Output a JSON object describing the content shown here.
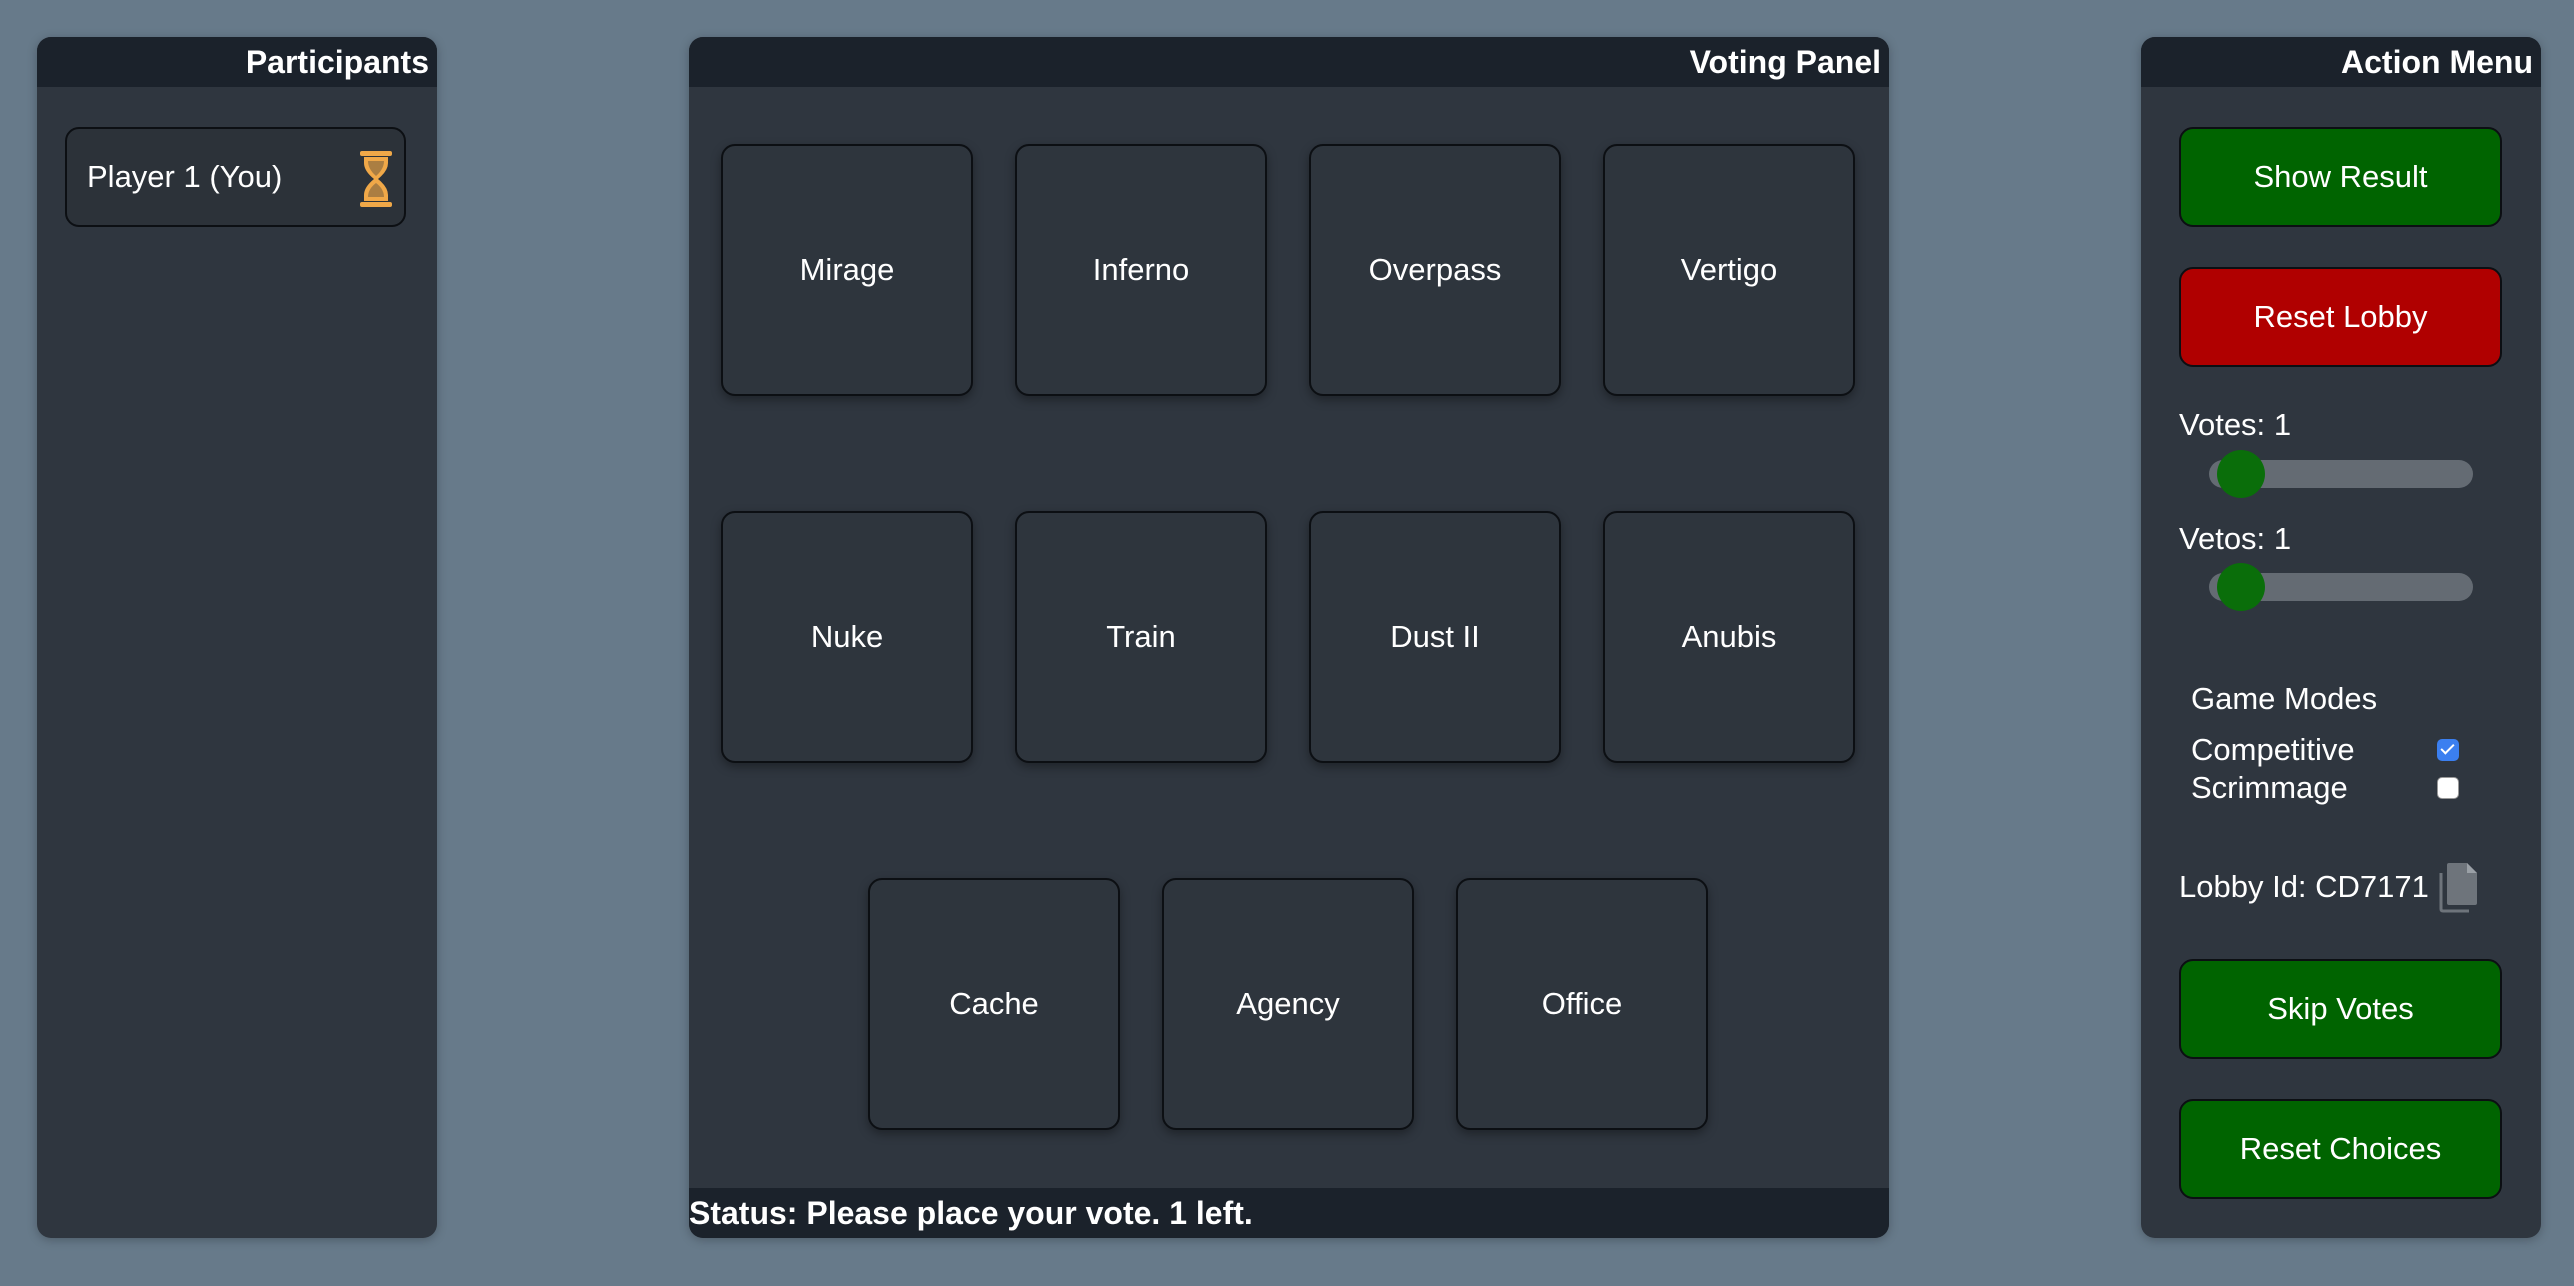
{
  "participants": {
    "title": "Participants",
    "players": [
      {
        "name": "Player 1 (You)",
        "status_icon": "hourglass-icon"
      }
    ]
  },
  "voting": {
    "title": "Voting Panel",
    "maps": [
      "Mirage",
      "Inferno",
      "Overpass",
      "Vertigo",
      "Nuke",
      "Train",
      "Dust II",
      "Anubis",
      "Cache",
      "Agency",
      "Office"
    ],
    "status": "Status: Please place your vote. 1 left."
  },
  "actions": {
    "title": "Action Menu",
    "show_result": "Show Result",
    "reset_lobby": "Reset Lobby",
    "votes_label": "Votes:",
    "votes_value": "1",
    "vetos_label": "Vetos:",
    "vetos_value": "1",
    "game_modes_title": "Game Modes",
    "modes": [
      {
        "label": "Competitive",
        "checked": true
      },
      {
        "label": "Scrimmage",
        "checked": false
      }
    ],
    "lobby_id": "Lobby Id: CD7171",
    "skip_votes": "Skip Votes",
    "reset_choices": "Reset Choices"
  },
  "colors": {
    "background": "#677a8a",
    "panel": "#2f363f",
    "header": "#1b222b",
    "green_button": "#006400",
    "red_button": "#b00000",
    "hourglass": "#f0a848",
    "checkbox_checked": "#3b7ff0"
  }
}
